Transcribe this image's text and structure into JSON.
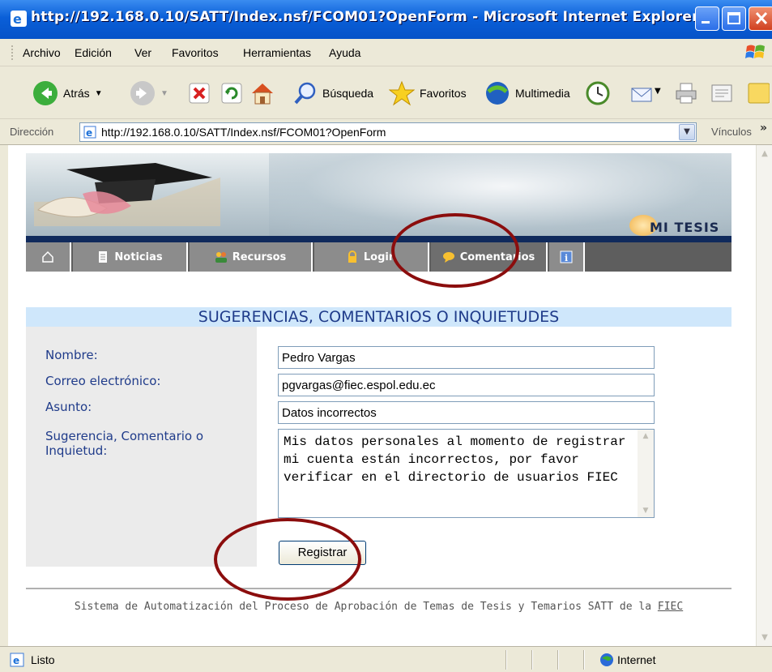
{
  "window": {
    "title": "http://192.168.0.10/SATT/Index.nsf/FCOM01?OpenForm - Microsoft Internet Explorer"
  },
  "menu": [
    "Archivo",
    "Edición",
    "Ver",
    "Favoritos",
    "Herramientas",
    "Ayuda"
  ],
  "toolbar": {
    "back": "Atrás",
    "search": "Búsqueda",
    "favorites": "Favoritos",
    "media": "Multimedia"
  },
  "address": {
    "label": "Dirección",
    "url": "http://192.168.0.10/SATT/Index.nsf/FCOM01?OpenForm",
    "links_label": "Vínculos",
    "more": "»"
  },
  "banner": {
    "logo_text": "MI TESIS"
  },
  "nav": {
    "home_icon": "home-icon",
    "items": [
      {
        "label": "Noticias",
        "icon": "document-icon"
      },
      {
        "label": "Recursos",
        "icon": "people-icon"
      },
      {
        "label": "Login",
        "icon": "lock-icon"
      },
      {
        "label": "Comentarios",
        "icon": "speech-bubble-icon"
      }
    ],
    "info_icon": "info-icon"
  },
  "form": {
    "header": "SUGERENCIAS, COMENTARIOS O INQUIETUDES",
    "fields": {
      "name": {
        "label": "Nombre:",
        "value": "Pedro Vargas"
      },
      "email": {
        "label": "Correo electrónico:",
        "value": "pgvargas@fiec.espol.edu.ec"
      },
      "subject": {
        "label": "Asunto:",
        "value": "Datos incorrectos"
      },
      "comment": {
        "label": "Sugerencia, Comentario o Inquietud:",
        "value": "Mis datos personales al momento de registrar mi cuenta están incorrectos, por favor verificar en el directorio de usuarios FIEC"
      }
    },
    "submit_label": "Registrar"
  },
  "footer": {
    "text": "Sistema de Automatización del Proceso de Aprobación de Temas de Tesis y Temarios SATT de la",
    "link": "FIEC"
  },
  "status": {
    "text": "Listo",
    "zone": "Internet"
  },
  "colors": {
    "header_band": "#cfe7fb",
    "header_text": "#1f3b8a",
    "annotation": "#8b0d0d",
    "nav_bar": "#8c8c8c"
  }
}
